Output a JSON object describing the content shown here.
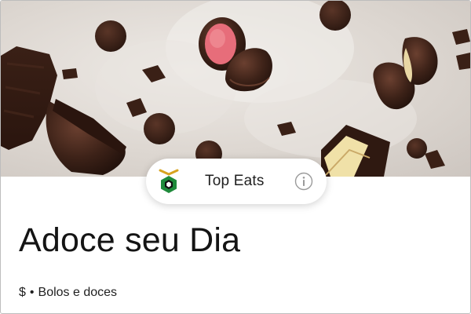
{
  "hero": {
    "image_alt": "chocolate bonbons and chocolate chips on a floured surface"
  },
  "badge": {
    "label": "Top Eats",
    "icon": "top-eats-hexagon-icon",
    "info_icon": "info-icon"
  },
  "store": {
    "name": "Adoce seu Dia",
    "price_tier": "$",
    "separator": "•",
    "category": "Bolos e doces"
  },
  "colors": {
    "badge_green": "#1f8a3b",
    "badge_gold": "#d8a320",
    "text": "#141414"
  }
}
